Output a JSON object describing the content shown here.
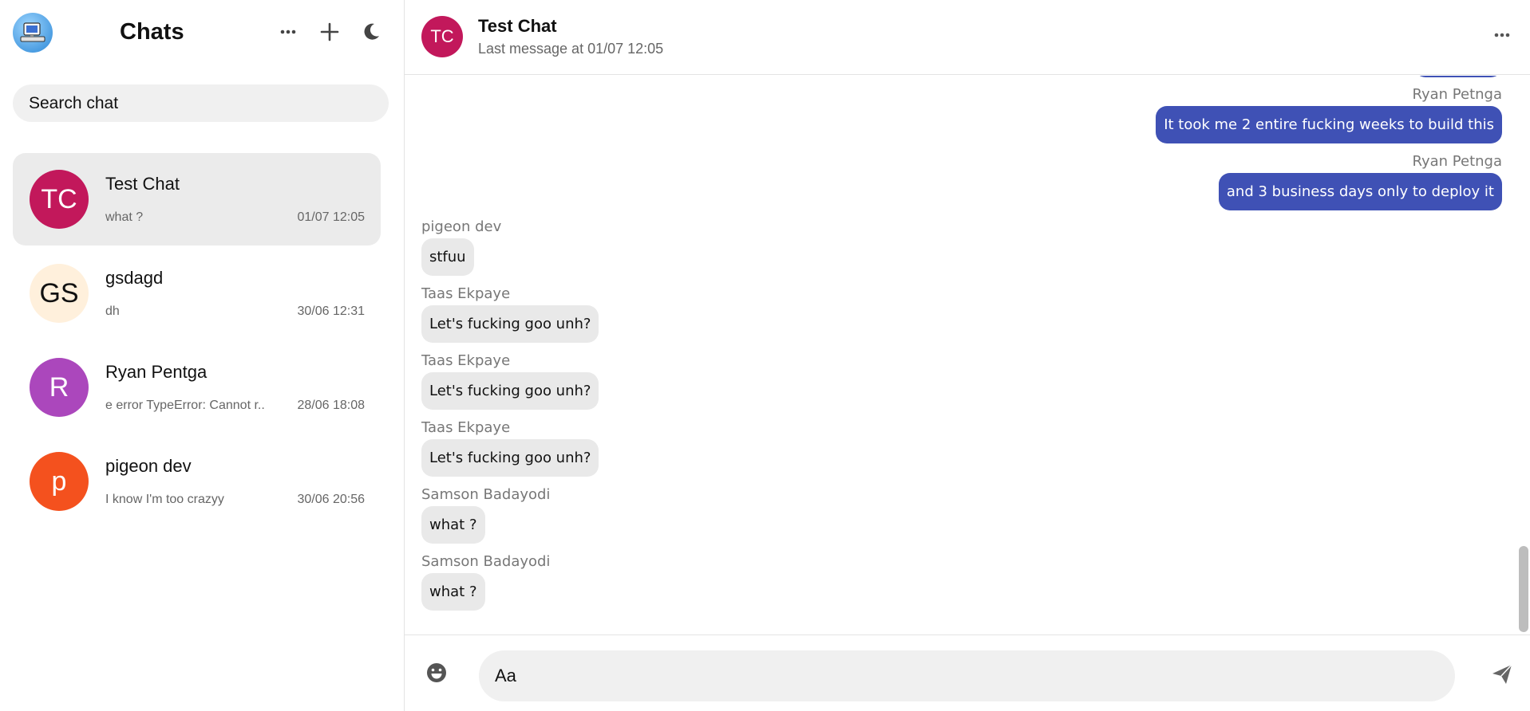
{
  "sidebar": {
    "title": "Chats",
    "search_placeholder": "Search chat",
    "chats": [
      {
        "initials": "TC",
        "name": "Test Chat",
        "preview": "what ?",
        "time": "01/07 12:05",
        "color": "#c2185b",
        "text_color": "#ffffff",
        "active": true
      },
      {
        "initials": "GS",
        "name": "gsdagd",
        "preview": "dh",
        "time": "30/06 12:31",
        "color": "#fff0dc",
        "text_color": "#111111",
        "active": false
      },
      {
        "initials": "R",
        "name": "Ryan Pentga",
        "preview": "e error TypeError: Cannot r...",
        "time": "28/06 18:08",
        "color": "#ab47bc",
        "text_color": "#ffffff",
        "active": false
      },
      {
        "initials": "p",
        "name": "pigeon dev",
        "preview": "I know I'm too crazyy",
        "time": "30/06 20:56",
        "color": "#f4511e",
        "text_color": "#ffffff",
        "active": false
      }
    ]
  },
  "header": {
    "initials": "TC",
    "title": "Test Chat",
    "subtitle": "Last message at 01/07 12:05",
    "avatar_color": "#c2185b"
  },
  "messages": [
    {
      "sender": "Ryan Petnga",
      "text": "It took me 2 entire fucking weeks to build this",
      "direction": "out"
    },
    {
      "sender": "Ryan Petnga",
      "text": "and 3 business days only to deploy it",
      "direction": "out"
    },
    {
      "sender": "pigeon dev",
      "text": "stfuu",
      "direction": "in"
    },
    {
      "sender": "Taas Ekpaye",
      "text": "Let's fucking goo unh?",
      "direction": "in"
    },
    {
      "sender": "Taas Ekpaye",
      "text": "Let's fucking goo unh?",
      "direction": "in"
    },
    {
      "sender": "Taas Ekpaye",
      "text": "Let's fucking goo unh?",
      "direction": "in"
    },
    {
      "sender": "Samson Badayodi",
      "text": "what ?",
      "direction": "in"
    },
    {
      "sender": "Samson Badayodi",
      "text": "what ?",
      "direction": "in"
    }
  ],
  "composer": {
    "placeholder": "Aa"
  },
  "colors": {
    "accent": "#3f51b5",
    "incoming_bubble": "#e9e9e9",
    "active_chat": "#ebebeb"
  },
  "icons": {
    "sidebar_more": "more-horizontal-icon",
    "new_chat": "plus-icon",
    "theme": "moon-icon",
    "header_more": "more-horizontal-icon",
    "emoji": "emoji-icon",
    "send": "send-icon"
  }
}
